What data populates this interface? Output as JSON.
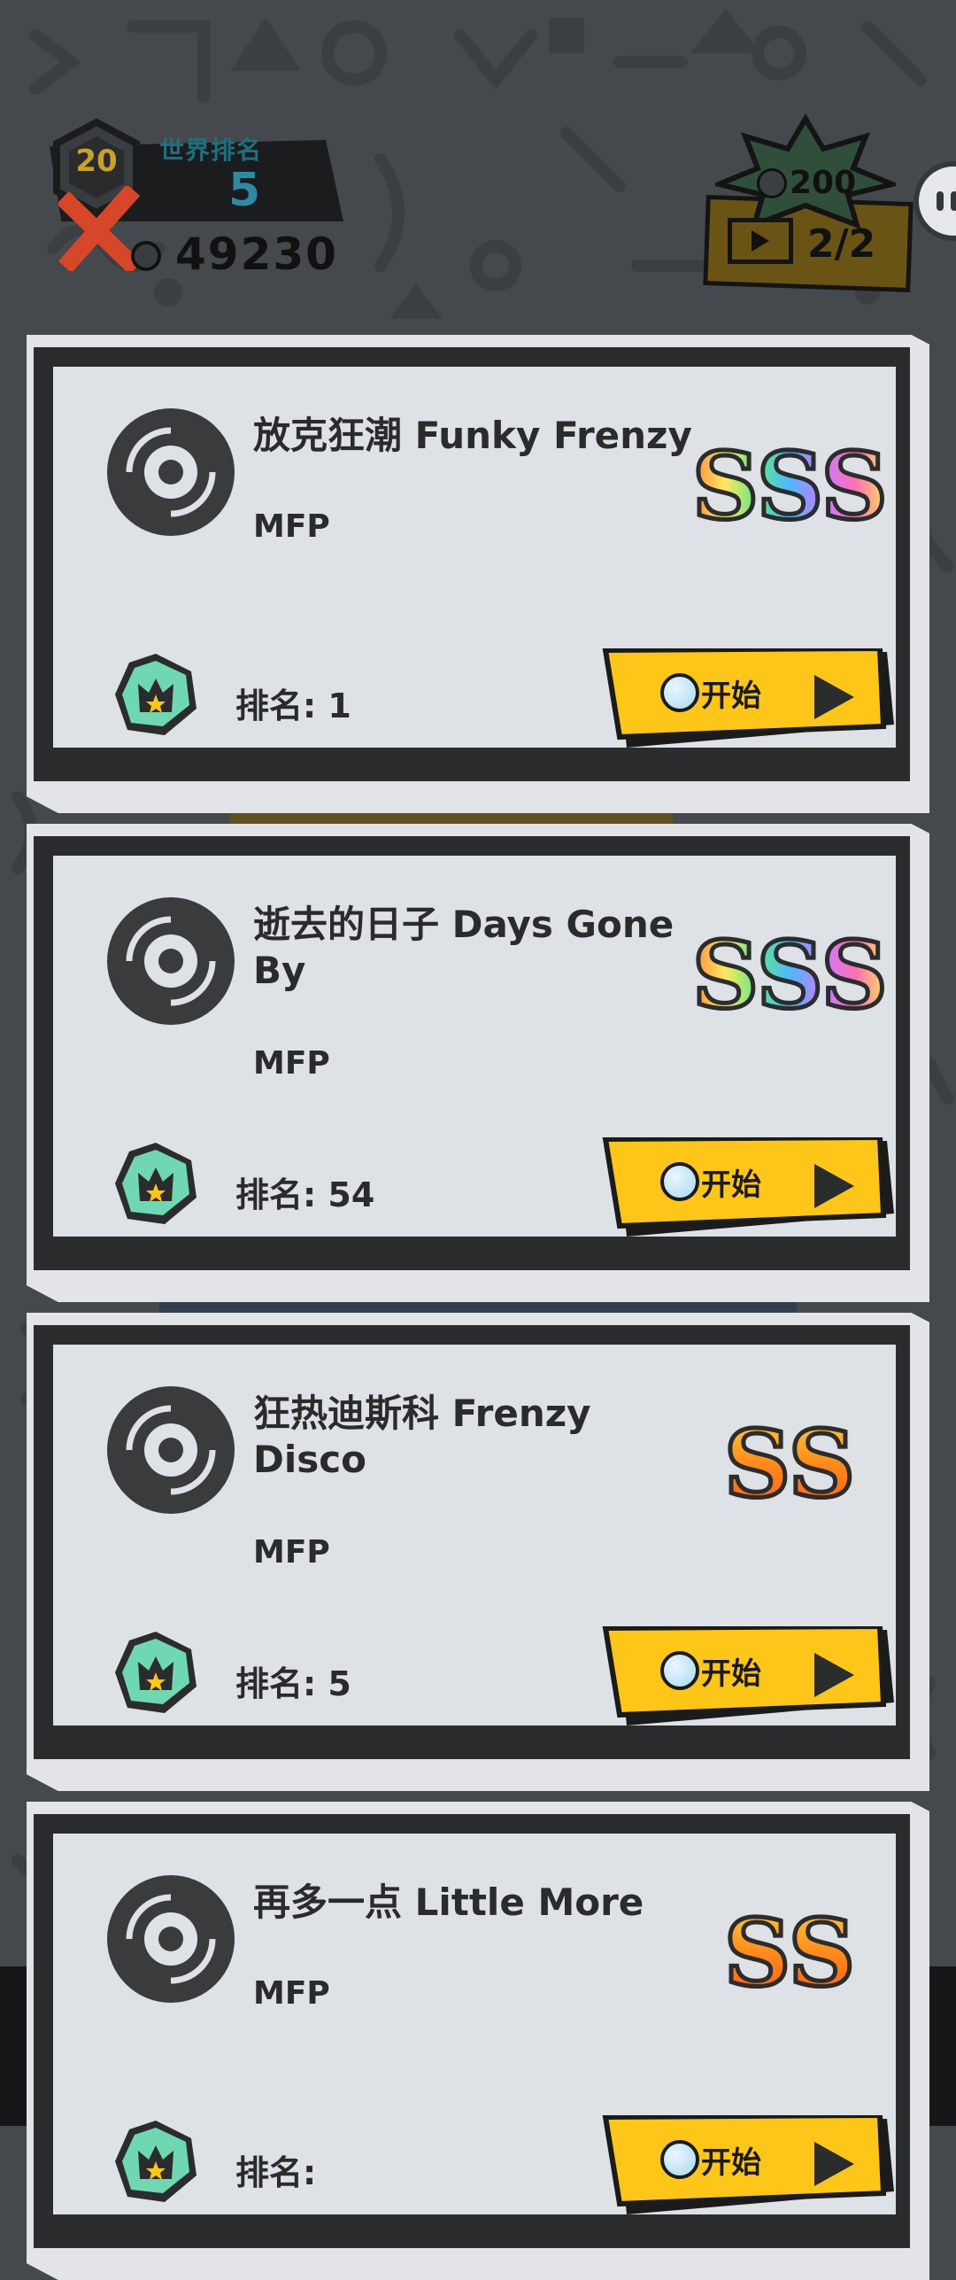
{
  "hud": {
    "level": "20",
    "world_rank_label": "世界排名",
    "world_rank_value": "5",
    "coins": "49230",
    "energy_cost": "200",
    "energy_count": "2/2",
    "icons": {
      "level": "hexagon-level-badge-icon",
      "fail": "red-x-icon",
      "coin": "coin-icon",
      "energy": "play-ticket-icon",
      "side": "chat-bubble-icon"
    }
  },
  "songs": [
    {
      "title": "放克狂潮 Funky Frenzy",
      "artist": "MFP",
      "grade": "SSS",
      "rank": "排名: 1",
      "start": "开始"
    },
    {
      "title": "逝去的日子 Days Gone By",
      "artist": "MFP",
      "grade": "SSS",
      "rank": "排名: 54",
      "start": "开始"
    },
    {
      "title": "狂热迪斯科 Frenzy Disco",
      "artist": "MFP",
      "grade": "SS",
      "rank": "排名: 5",
      "start": "开始"
    },
    {
      "title": "再多一点 Little More",
      "artist": "MFP",
      "grade": "SS",
      "rank": "排名: ",
      "start": "开始"
    }
  ],
  "colors": {
    "background": "#45484c",
    "card": "#e2e4e7",
    "button": "#ffc61a",
    "rank_badge": "#6fd8b2",
    "dark": "#2b2c2e"
  }
}
